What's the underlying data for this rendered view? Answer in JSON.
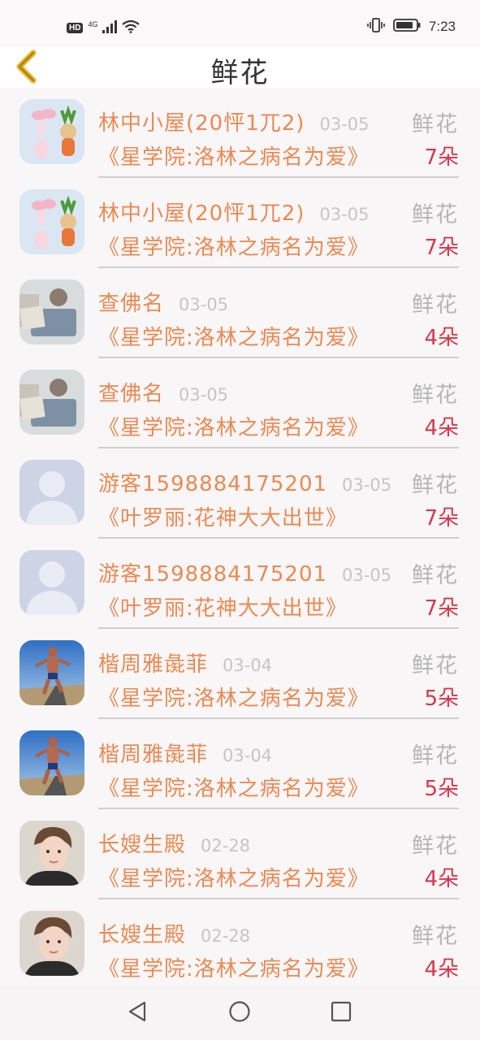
{
  "status_bar": {
    "hd_label": "HD",
    "network_label": "4G",
    "time": "7:23",
    "icons": [
      "signal-icon",
      "wifi-icon",
      "vibrate-icon",
      "battery-icon"
    ]
  },
  "header": {
    "title": "鲜花",
    "back_icon": "chevron-left-icon",
    "accent_color": "#e8b020"
  },
  "gifts": [
    {
      "user": "林中小屋(20怦1兀2)",
      "date": "03-05",
      "type": "鲜花",
      "book": "《星学院:洛林之病名为爱》",
      "count": "7朵",
      "avatar": "bunny-carrot-figurines"
    },
    {
      "user": "林中小屋(20怦1兀2)",
      "date": "03-05",
      "type": "鲜花",
      "book": "《星学院:洛林之病名为爱》",
      "count": "7朵",
      "avatar": "bunny-carrot-figurines"
    },
    {
      "user": "查佛名",
      "date": "03-05",
      "type": "鲜花",
      "book": "《星学院:洛林之病名为爱》",
      "count": "4朵",
      "avatar": "person-reading-newspaper"
    },
    {
      "user": "查佛名",
      "date": "03-05",
      "type": "鲜花",
      "book": "《星学院:洛林之病名为爱》",
      "count": "4朵",
      "avatar": "person-reading-newspaper"
    },
    {
      "user": "游客1598884175201",
      "date": "03-05",
      "type": "鲜花",
      "book": "《叶罗丽:花神大大出世》",
      "count": "7朵",
      "avatar": "default-user"
    },
    {
      "user": "游客1598884175201",
      "date": "03-05",
      "type": "鲜花",
      "book": "《叶罗丽:花神大大出世》",
      "count": "7朵",
      "avatar": "default-user"
    },
    {
      "user": "楷周雅彘菲",
      "date": "03-04",
      "type": "鲜花",
      "book": "《星学院:洛林之病名为爱》",
      "count": "5朵",
      "avatar": "runner-on-road"
    },
    {
      "user": "楷周雅彘菲",
      "date": "03-04",
      "type": "鲜花",
      "book": "《星学院:洛林之病名为爱》",
      "count": "5朵",
      "avatar": "runner-on-road"
    },
    {
      "user": "长嫂生殿",
      "date": "02-28",
      "type": "鲜花",
      "book": "《星学院:洛林之病名为爱》",
      "count": "4朵",
      "avatar": "boy-portrait"
    },
    {
      "user": "长嫂生殿",
      "date": "02-28",
      "type": "鲜花",
      "book": "《星学院:洛林之病名为爱》",
      "count": "4朵",
      "avatar": "boy-portrait"
    }
  ],
  "colors": {
    "name_text": "#e98a55",
    "count_text": "#d6384a",
    "type_text": "#b5b5b5",
    "date_text": "#c5c5c5"
  },
  "nav_bar": {
    "icons": [
      "back-triangle-icon",
      "home-circle-icon",
      "recents-square-icon"
    ]
  }
}
